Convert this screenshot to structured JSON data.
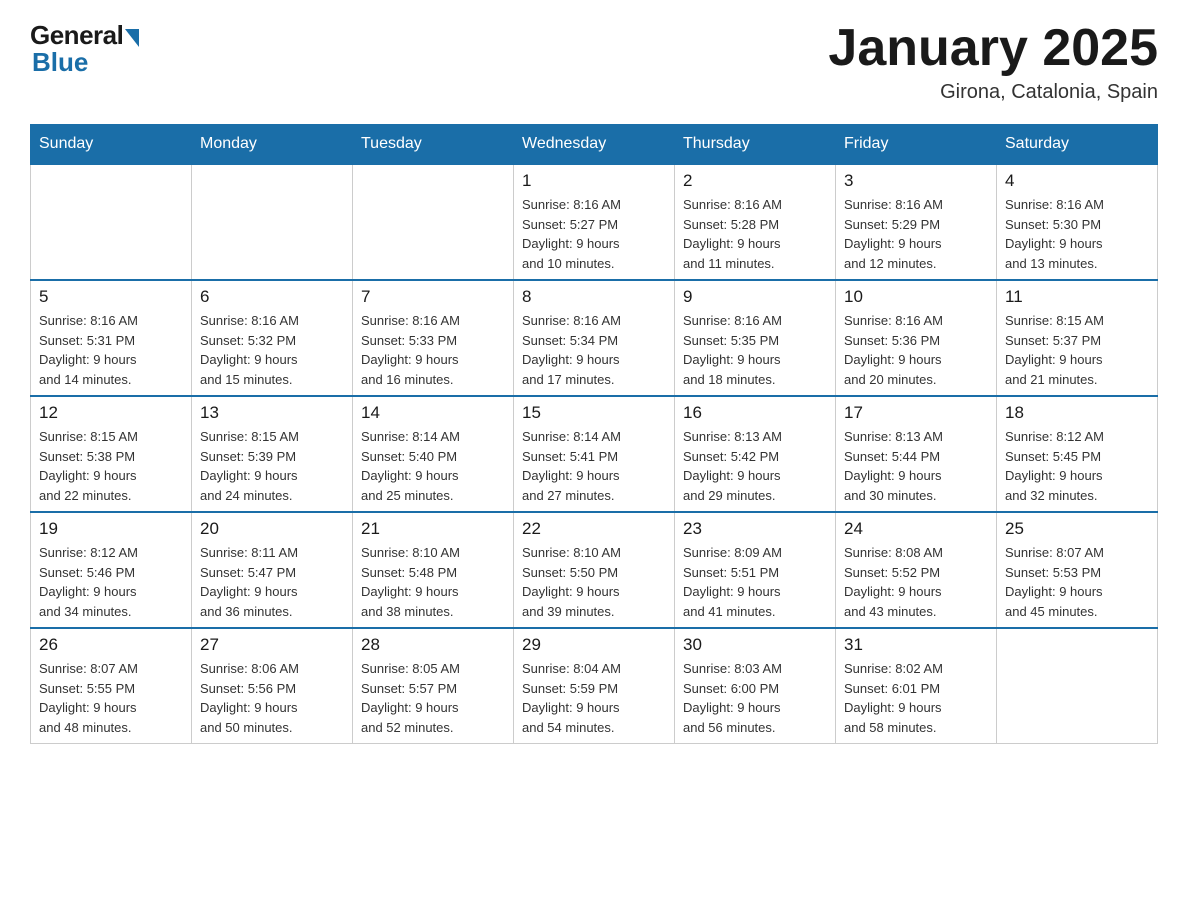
{
  "header": {
    "logo": {
      "general": "General",
      "blue": "Blue"
    },
    "title": "January 2025",
    "location": "Girona, Catalonia, Spain"
  },
  "calendar": {
    "days_of_week": [
      "Sunday",
      "Monday",
      "Tuesday",
      "Wednesday",
      "Thursday",
      "Friday",
      "Saturday"
    ],
    "weeks": [
      [
        {
          "day": "",
          "info": ""
        },
        {
          "day": "",
          "info": ""
        },
        {
          "day": "",
          "info": ""
        },
        {
          "day": "1",
          "info": "Sunrise: 8:16 AM\nSunset: 5:27 PM\nDaylight: 9 hours\nand 10 minutes."
        },
        {
          "day": "2",
          "info": "Sunrise: 8:16 AM\nSunset: 5:28 PM\nDaylight: 9 hours\nand 11 minutes."
        },
        {
          "day": "3",
          "info": "Sunrise: 8:16 AM\nSunset: 5:29 PM\nDaylight: 9 hours\nand 12 minutes."
        },
        {
          "day": "4",
          "info": "Sunrise: 8:16 AM\nSunset: 5:30 PM\nDaylight: 9 hours\nand 13 minutes."
        }
      ],
      [
        {
          "day": "5",
          "info": "Sunrise: 8:16 AM\nSunset: 5:31 PM\nDaylight: 9 hours\nand 14 minutes."
        },
        {
          "day": "6",
          "info": "Sunrise: 8:16 AM\nSunset: 5:32 PM\nDaylight: 9 hours\nand 15 minutes."
        },
        {
          "day": "7",
          "info": "Sunrise: 8:16 AM\nSunset: 5:33 PM\nDaylight: 9 hours\nand 16 minutes."
        },
        {
          "day": "8",
          "info": "Sunrise: 8:16 AM\nSunset: 5:34 PM\nDaylight: 9 hours\nand 17 minutes."
        },
        {
          "day": "9",
          "info": "Sunrise: 8:16 AM\nSunset: 5:35 PM\nDaylight: 9 hours\nand 18 minutes."
        },
        {
          "day": "10",
          "info": "Sunrise: 8:16 AM\nSunset: 5:36 PM\nDaylight: 9 hours\nand 20 minutes."
        },
        {
          "day": "11",
          "info": "Sunrise: 8:15 AM\nSunset: 5:37 PM\nDaylight: 9 hours\nand 21 minutes."
        }
      ],
      [
        {
          "day": "12",
          "info": "Sunrise: 8:15 AM\nSunset: 5:38 PM\nDaylight: 9 hours\nand 22 minutes."
        },
        {
          "day": "13",
          "info": "Sunrise: 8:15 AM\nSunset: 5:39 PM\nDaylight: 9 hours\nand 24 minutes."
        },
        {
          "day": "14",
          "info": "Sunrise: 8:14 AM\nSunset: 5:40 PM\nDaylight: 9 hours\nand 25 minutes."
        },
        {
          "day": "15",
          "info": "Sunrise: 8:14 AM\nSunset: 5:41 PM\nDaylight: 9 hours\nand 27 minutes."
        },
        {
          "day": "16",
          "info": "Sunrise: 8:13 AM\nSunset: 5:42 PM\nDaylight: 9 hours\nand 29 minutes."
        },
        {
          "day": "17",
          "info": "Sunrise: 8:13 AM\nSunset: 5:44 PM\nDaylight: 9 hours\nand 30 minutes."
        },
        {
          "day": "18",
          "info": "Sunrise: 8:12 AM\nSunset: 5:45 PM\nDaylight: 9 hours\nand 32 minutes."
        }
      ],
      [
        {
          "day": "19",
          "info": "Sunrise: 8:12 AM\nSunset: 5:46 PM\nDaylight: 9 hours\nand 34 minutes."
        },
        {
          "day": "20",
          "info": "Sunrise: 8:11 AM\nSunset: 5:47 PM\nDaylight: 9 hours\nand 36 minutes."
        },
        {
          "day": "21",
          "info": "Sunrise: 8:10 AM\nSunset: 5:48 PM\nDaylight: 9 hours\nand 38 minutes."
        },
        {
          "day": "22",
          "info": "Sunrise: 8:10 AM\nSunset: 5:50 PM\nDaylight: 9 hours\nand 39 minutes."
        },
        {
          "day": "23",
          "info": "Sunrise: 8:09 AM\nSunset: 5:51 PM\nDaylight: 9 hours\nand 41 minutes."
        },
        {
          "day": "24",
          "info": "Sunrise: 8:08 AM\nSunset: 5:52 PM\nDaylight: 9 hours\nand 43 minutes."
        },
        {
          "day": "25",
          "info": "Sunrise: 8:07 AM\nSunset: 5:53 PM\nDaylight: 9 hours\nand 45 minutes."
        }
      ],
      [
        {
          "day": "26",
          "info": "Sunrise: 8:07 AM\nSunset: 5:55 PM\nDaylight: 9 hours\nand 48 minutes."
        },
        {
          "day": "27",
          "info": "Sunrise: 8:06 AM\nSunset: 5:56 PM\nDaylight: 9 hours\nand 50 minutes."
        },
        {
          "day": "28",
          "info": "Sunrise: 8:05 AM\nSunset: 5:57 PM\nDaylight: 9 hours\nand 52 minutes."
        },
        {
          "day": "29",
          "info": "Sunrise: 8:04 AM\nSunset: 5:59 PM\nDaylight: 9 hours\nand 54 minutes."
        },
        {
          "day": "30",
          "info": "Sunrise: 8:03 AM\nSunset: 6:00 PM\nDaylight: 9 hours\nand 56 minutes."
        },
        {
          "day": "31",
          "info": "Sunrise: 8:02 AM\nSunset: 6:01 PM\nDaylight: 9 hours\nand 58 minutes."
        },
        {
          "day": "",
          "info": ""
        }
      ]
    ]
  }
}
